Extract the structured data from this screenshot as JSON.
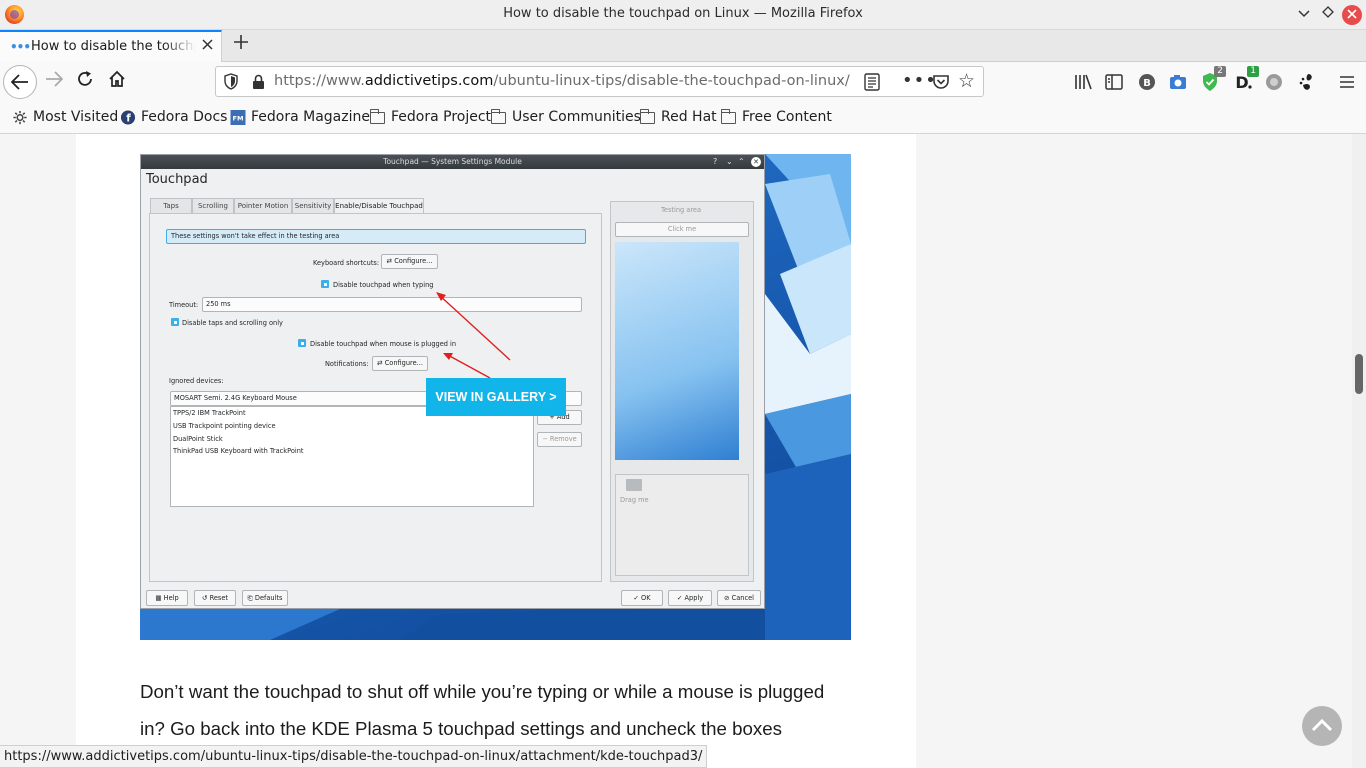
{
  "window": {
    "title": "How to disable the touchpad on Linux — Mozilla Firefox"
  },
  "tab": {
    "title": "How to disable the touchpad on Linux"
  },
  "urlbar": {
    "prefix": "https://www.",
    "domain": "addictivetips.com",
    "path": "/ubuntu-linux-tips/disable-the-touchpad-on-linux/"
  },
  "toolbar_badges": {
    "shield_count": "2",
    "d_count": "1"
  },
  "bookmarks": [
    {
      "label": "Most Visited",
      "icon": "gear-icon"
    },
    {
      "label": "Fedora Docs",
      "icon": "fedora-icon"
    },
    {
      "label": "Fedora Magazine",
      "icon": "fm-icon"
    },
    {
      "label": "Fedora Project",
      "icon": "folder-icon"
    },
    {
      "label": "User Communities",
      "icon": "folder-icon"
    },
    {
      "label": "Red Hat",
      "icon": "folder-icon"
    },
    {
      "label": "Free Content",
      "icon": "folder-icon"
    }
  ],
  "screenshot": {
    "window_title": "Touchpad — System Settings Module",
    "heading": "Touchpad",
    "tabs": [
      "Taps",
      "Scrolling",
      "Pointer Motion",
      "Sensitivity",
      "Enable/Disable Touchpad"
    ],
    "info_message": "These settings won't take effect in the testing area",
    "keyboard_shortcuts_label": "Keyboard shortcuts:",
    "configure_label": "Configure...",
    "disable_when_typing": "Disable touchpad when typing",
    "timeout_label": "Timeout:",
    "timeout_value": "250 ms",
    "disable_taps_scrolling": "Disable taps and scrolling only",
    "disable_when_mouse": "Disable touchpad when mouse is plugged in",
    "notifications_label": "Notifications:",
    "ignored_devices_label": "Ignored devices:",
    "ignored_combo": "MOSART Semi. 2.4G Keyboard Mouse",
    "devices": [
      "TPPS/2 IBM TrackPoint",
      "USB Trackpoint pointing device",
      "DualPoint Stick",
      "ThinkPad USB Keyboard with TrackPoint"
    ],
    "add_label": "Add",
    "remove_label": "Remove",
    "testing_area": "Testing area",
    "click_me": "Click me",
    "drag_me": "Drag me",
    "help": "Help",
    "reset": "Reset",
    "defaults": "Defaults",
    "ok": "OK",
    "apply": "Apply",
    "cancel": "Cancel"
  },
  "gallery_button": "VIEW IN GALLERY >",
  "paragraph": "Don’t want the touchpad to shut off while you’re typing or while a mouse is plugged in? Go back into the KDE Plasma 5 touchpad settings and uncheck the boxes",
  "status_url": "https://www.addictivetips.com/ubuntu-linux-tips/disable-the-touchpad-on-linux/attachment/kde-touchpad3/",
  "colors": {
    "accent": "#0a84ff",
    "gallery": "#12b5ea",
    "kde_blue": "#3daee9"
  }
}
